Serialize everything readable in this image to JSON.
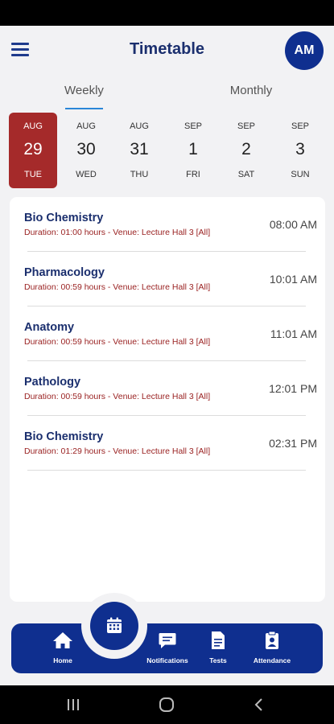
{
  "header": {
    "title": "Timetable",
    "avatar_initials": "AM"
  },
  "tabs": [
    {
      "label": "Weekly",
      "active": true
    },
    {
      "label": "Monthly",
      "active": false
    }
  ],
  "days": [
    {
      "month": "AUG",
      "day": "29",
      "weekday": "TUE",
      "selected": true
    },
    {
      "month": "AUG",
      "day": "30",
      "weekday": "WED",
      "selected": false
    },
    {
      "month": "AUG",
      "day": "31",
      "weekday": "THU",
      "selected": false
    },
    {
      "month": "SEP",
      "day": "1",
      "weekday": "FRI",
      "selected": false
    },
    {
      "month": "SEP",
      "day": "2",
      "weekday": "SAT",
      "selected": false
    },
    {
      "month": "SEP",
      "day": "3",
      "weekday": "SUN",
      "selected": false
    }
  ],
  "schedule": [
    {
      "subject": "Bio Chemistry",
      "details": "Duration: 01:00 hours - Venue: Lecture Hall 3 [All]",
      "time": "08:00 AM"
    },
    {
      "subject": "Pharmacology",
      "details": "Duration: 00:59 hours - Venue: Lecture Hall 3 [All]",
      "time": "10:01 AM"
    },
    {
      "subject": "Anatomy",
      "details": "Duration: 00:59 hours - Venue: Lecture Hall 3 [All]",
      "time": "11:01 AM"
    },
    {
      "subject": "Pathology",
      "details": "Duration: 00:59 hours - Venue: Lecture Hall 3 [All]",
      "time": "12:01 PM"
    },
    {
      "subject": "Bio Chemistry",
      "details": "Duration: 01:29 hours - Venue: Lecture Hall 3 [All]",
      "time": "02:31 PM"
    }
  ],
  "bottom_nav": {
    "center_icon": "calendar-icon",
    "items": [
      {
        "label": "Home",
        "icon": "home-icon"
      },
      {
        "label": "Notifications",
        "icon": "message-icon"
      },
      {
        "label": "Tests",
        "icon": "document-icon"
      },
      {
        "label": "Attendance",
        "icon": "clipboard-user-icon"
      }
    ]
  },
  "colors": {
    "brand": "#0f2f8f",
    "selected_day": "#a52a2a",
    "title": "#1b2f6e",
    "detail": "#9a2222",
    "tab_indicator": "#2a86d8"
  }
}
